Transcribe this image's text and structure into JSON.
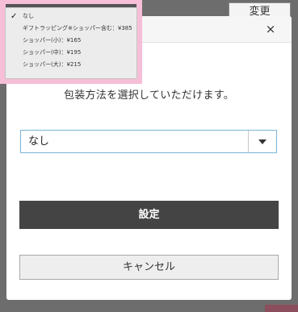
{
  "background": {
    "change_button_label": "変更"
  },
  "modal": {
    "close_icon": "×",
    "instruction": "包装方法を選択していただけます。",
    "select": {
      "value": "なし",
      "arrow_icon": "caret-down"
    },
    "primary_button_label": "設定",
    "secondary_button_label": "キャンセル"
  },
  "dropdown": {
    "selected_index": 0,
    "options": [
      "なし",
      "ギフトラッピング※ショッパー含む：¥385",
      "ショッパー(小)：¥165",
      "ショッパー(中)：¥195",
      "ショッパー(大)：¥215"
    ]
  },
  "colors": {
    "overlay": "#6d6d6d",
    "primary_button": "#444444",
    "select_border": "#7ab4d6",
    "highlight": "#f7bed8"
  }
}
